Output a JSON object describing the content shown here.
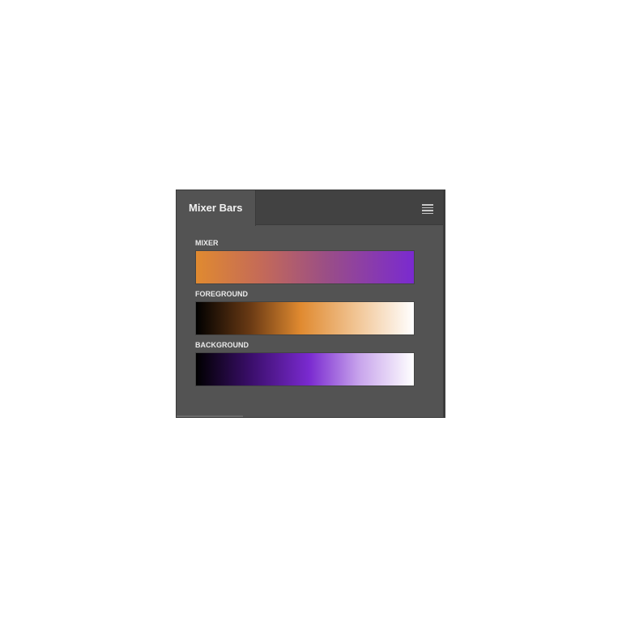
{
  "panel": {
    "tab_label": "Mixer Bars",
    "menu_icon": "hamburger-menu-icon"
  },
  "bars": [
    {
      "label": "MIXER",
      "start_color": "#e08a30",
      "end_color": "#7a2ad0"
    },
    {
      "label": "FOREGROUND",
      "start_color": "#000000",
      "mid_color": "#e08a30",
      "end_color": "#ffffff"
    },
    {
      "label": "BACKGROUND",
      "start_color": "#000000",
      "mid_color": "#7a2ad0",
      "end_color": "#ffffff"
    }
  ],
  "colors": {
    "panel_bg": "#535353",
    "tab_bar_bg": "#424242",
    "foreground": "#e08a30",
    "background": "#7a2ad0"
  }
}
